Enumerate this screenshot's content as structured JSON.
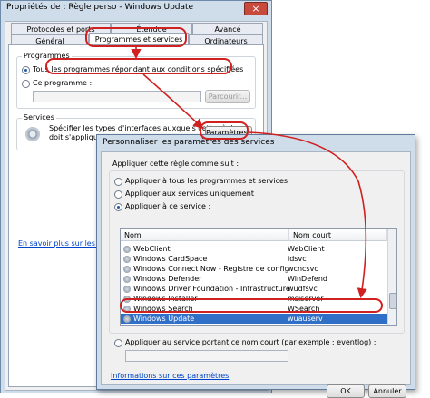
{
  "back_window": {
    "title": "Propriétés de : Règle perso - Windows Update",
    "close_glyph": "×",
    "tabs_row1": [
      "Protocoles et ports",
      "Étendue",
      "Avancé"
    ],
    "tabs_row2": [
      "Général",
      "Programmes et services",
      "Ordinateurs"
    ],
    "programs_group": "Programmes",
    "radio_all_programs": "Tous les programmes répondant aux conditions spécifiées",
    "radio_this_program": "Ce programme :",
    "browse_button": "Parcourir...",
    "services_group": "Services",
    "services_text_line1": "Spécifier les types d'interfaces auxquels cette règle",
    "services_text_line2": "doit s'appliquer.",
    "settings_button": "Paramètres...",
    "learn_more_link": "En savoir plus sur les program"
  },
  "dialog": {
    "title": "Personnaliser les paramètres des services",
    "apply_rule_label": "Appliquer cette règle comme suit :",
    "radio_all": "Appliquer à tous les programmes et services",
    "radio_services_only": "Appliquer aux services uniquement",
    "radio_this_service": "Appliquer à ce service :",
    "columns": [
      "Nom",
      "Nom court"
    ],
    "services": [
      {
        "name": "WebClient",
        "short": "WebClient"
      },
      {
        "name": "Windows CardSpace",
        "short": "idsvc"
      },
      {
        "name": "Windows Connect Now - Registre de configuration",
        "short": "wcncsvc"
      },
      {
        "name": "Windows Defender",
        "short": "WinDefend"
      },
      {
        "name": "Windows Driver Foundation - Infrastructure de pilote m...",
        "short": "wudfsvc"
      },
      {
        "name": "Windows Installer",
        "short": "msiserver"
      },
      {
        "name": "Windows Search",
        "short": "WSearch"
      },
      {
        "name": "Windows Update",
        "short": "wuauserv"
      }
    ],
    "selected_service": "Windows Update",
    "radio_short_name": "Appliquer au service portant ce nom court (par exemple : eventlog) :",
    "info_link": "Informations sur ces paramètres",
    "ok_button": "OK",
    "cancel_button": "Annuler"
  },
  "colors": {
    "annotation": "#d02020",
    "selection": "#2f6fc8",
    "link": "#0044cc"
  }
}
